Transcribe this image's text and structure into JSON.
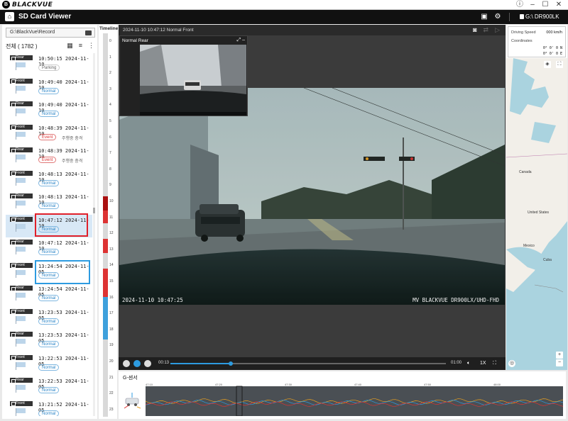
{
  "titlebar": {
    "brand": "BLACKVUE"
  },
  "appbar": {
    "title": "SD Card Viewer",
    "device": "G:\\ DR900LK"
  },
  "left_panel": {
    "path": "G:\\BlackVue\\Record",
    "count_label": "전체 ( 1782 )",
    "items": [
      {
        "cam": "Rear",
        "time": "10:50:15 2024-11-10",
        "badge": "Parking",
        "kind": "parking",
        "note": ""
      },
      {
        "cam": "Front",
        "time": "10:49:40 2024-11-10",
        "badge": "Normal",
        "kind": "normal",
        "note": ""
      },
      {
        "cam": "Rear",
        "time": "10:49:40 2024-11-10",
        "badge": "Normal",
        "kind": "normal",
        "note": ""
      },
      {
        "cam": "Front",
        "time": "10:48:39 2024-11-10",
        "badge": "Event",
        "kind": "event",
        "note": "주행중 충격"
      },
      {
        "cam": "Rear",
        "time": "10:48:39 2024-11-10",
        "badge": "Event",
        "kind": "event",
        "note": "주행중 충격"
      },
      {
        "cam": "Front",
        "time": "10:48:13 2024-11-10",
        "badge": "Normal",
        "kind": "normal",
        "note": ""
      },
      {
        "cam": "Rear",
        "time": "10:48:13 2024-11-10",
        "badge": "Normal",
        "kind": "normal",
        "note": ""
      },
      {
        "cam": "Front",
        "time": "10:47:12 2024-11-10",
        "badge": "Normal",
        "kind": "normal",
        "note": ""
      },
      {
        "cam": "Rear",
        "time": "10:47:12 2024-11-10",
        "badge": "Normal",
        "kind": "normal",
        "note": ""
      },
      {
        "cam": "Front",
        "time": "13:24:54 2024-11-05",
        "badge": "Normal",
        "kind": "normal",
        "note": ""
      },
      {
        "cam": "Rear",
        "time": "13:24:54 2024-11-05",
        "badge": "Normal",
        "kind": "normal",
        "note": ""
      },
      {
        "cam": "Front",
        "time": "13:23:53 2024-11-05",
        "badge": "Normal",
        "kind": "normal",
        "note": ""
      },
      {
        "cam": "Rear",
        "time": "13:23:53 2024-11-05",
        "badge": "Normal",
        "kind": "normal",
        "note": ""
      },
      {
        "cam": "Front",
        "time": "13:22:53 2024-11-05",
        "badge": "Normal",
        "kind": "normal",
        "note": ""
      },
      {
        "cam": "Rear",
        "time": "13:22:53 2024-11-05",
        "badge": "Normal",
        "kind": "normal",
        "note": ""
      },
      {
        "cam": "Front",
        "time": "13:21:52 2024-11-05",
        "badge": "Normal",
        "kind": "normal",
        "note": ""
      }
    ]
  },
  "timeline": {
    "title": "Timeline",
    "hours": [
      "0",
      "1",
      "2",
      "3",
      "4",
      "5",
      "6",
      "7",
      "8",
      "9",
      "10",
      "11",
      "12",
      "13",
      "14",
      "15",
      "16",
      "17",
      "18",
      "19",
      "20",
      "21",
      "22",
      "23"
    ]
  },
  "player": {
    "header": "2024-11-10 10:47:12 Normal Front",
    "pip_label": "Normal Rear",
    "osd_left": "2024-11-10 10:47:25",
    "osd_right": "MV  BLACKVUE DR900LX/UHD-FHD",
    "time_current": "00:13",
    "time_total": "01:00",
    "speed_rate": "1X",
    "progress": 0.22
  },
  "map_panel": {
    "speed_label": "Driving Speed",
    "speed_value": "000 km/h",
    "coords_label": "Coordinates",
    "lat": "0° 0'   0 N",
    "lon": "0° 0'   0 E",
    "places": [
      "Canada",
      "United States",
      "Mexico",
      "Cuba"
    ]
  },
  "gsensor": {
    "title": "G-센서",
    "ticks": [
      "47:10",
      "47:20",
      "47:30",
      "47:40",
      "47:50",
      "48:00"
    ]
  },
  "colors": {
    "accent": "#2d9be0",
    "event": "#d33333",
    "highlight_red": "#e0202a",
    "highlight_blue": "#2d9be0"
  }
}
